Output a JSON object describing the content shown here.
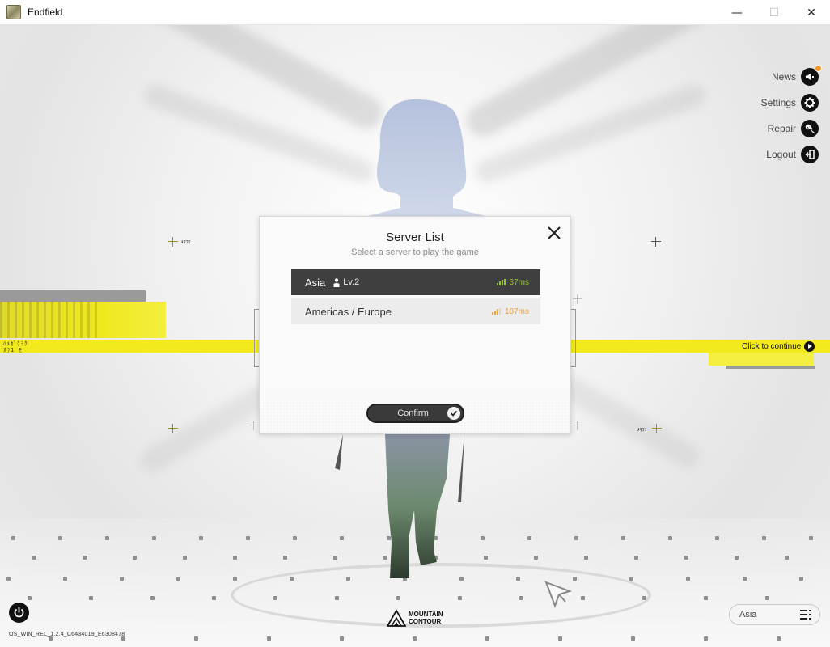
{
  "window": {
    "title": "Endfield",
    "minimize": "—",
    "maximize": "☐",
    "close": "✕"
  },
  "side_menu": [
    {
      "label": "News",
      "icon": "megaphone-icon"
    },
    {
      "label": "Settings",
      "icon": "gear-icon"
    },
    {
      "label": "Repair",
      "icon": "wrench-icon"
    },
    {
      "label": "Logout",
      "icon": "logout-icon"
    }
  ],
  "banner": {
    "click_to_continue": "Click to continue",
    "left_code": "ﾊﾒｶﾞｸﾐｸ\nﾇﾗ1 ﾓ",
    "micro_label": "ﾒﾏﾌﾐ"
  },
  "dialog": {
    "title": "Server List",
    "subtitle": "Select a server to play the game",
    "servers": [
      {
        "name": "Asia",
        "level": "Lv.2",
        "ping": "37ms",
        "ping_color": "#93c52a",
        "selected": true
      },
      {
        "name": "Americas / Europe",
        "level": "",
        "ping": "187ms",
        "ping_color": "#eaa23d",
        "selected": false
      }
    ],
    "confirm": "Confirm"
  },
  "footer": {
    "build": "OS_WIN_REL_1.2.4_C6434019_E6308478",
    "logo_line1": "MOUNTAIN",
    "logo_line2": "CONTOUR",
    "region": "Asia"
  },
  "colors": {
    "accent_yellow": "#f2ea1c",
    "dark": "#3f3f3f"
  }
}
